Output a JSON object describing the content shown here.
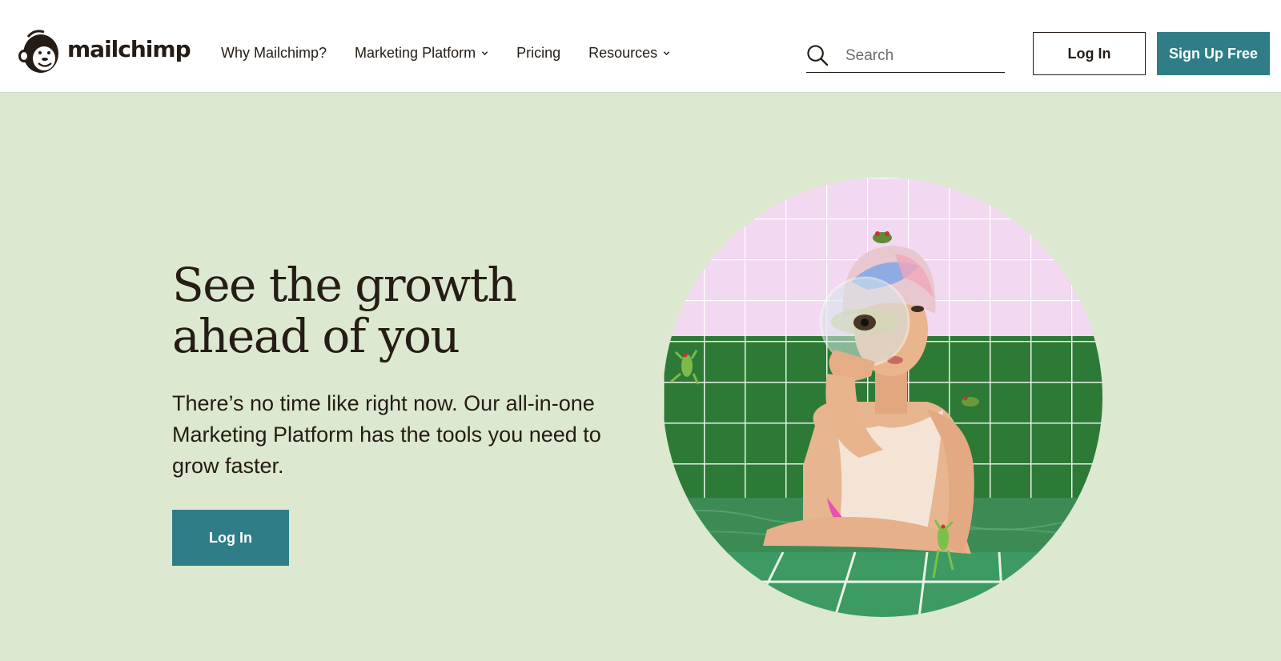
{
  "brand": {
    "name": "mailchimp",
    "accent": "#2e7d87",
    "hero_bg": "#dce8cf"
  },
  "nav": {
    "items": [
      {
        "label": "Why Mailchimp?",
        "has_dropdown": false
      },
      {
        "label": "Marketing Platform",
        "has_dropdown": true
      },
      {
        "label": "Pricing",
        "has_dropdown": false
      },
      {
        "label": "Resources",
        "has_dropdown": true
      }
    ]
  },
  "search": {
    "placeholder": "Search",
    "value": "",
    "icon": "search-icon"
  },
  "header_actions": {
    "login_label": "Log In",
    "signup_label": "Sign Up Free"
  },
  "hero": {
    "title": "See the growth ahead of you",
    "body": "There’s no time like right now. Our all-in-one Marketing Platform has the tools you need to grow faster.",
    "cta_label": "Log In"
  }
}
